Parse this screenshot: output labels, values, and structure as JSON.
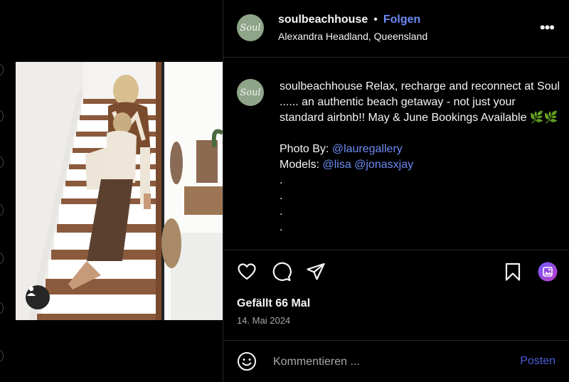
{
  "post": {
    "username": "soulbeachhouse",
    "separator": "•",
    "follow_label": "Folgen",
    "location": "Alexandra Headland, Queensland",
    "more_label": "•••",
    "avatar_text": "Soul",
    "caption": {
      "username": "soulbeachhouse",
      "text_line": " Relax, recharge and reconnect at Soul ...... an authentic beach getaway - not just your standard airbnb!! May & June Bookings Available 🌿🌿",
      "photo_label": "Photo By: ",
      "photo_link": "@lauregallery",
      "models_label": "Models: ",
      "models_link_1": "@lisa",
      "models_link_2": "@jonasxjay",
      "dots": [
        ".",
        ".",
        ".",
        "."
      ]
    },
    "likes": "Gefällt 66 Mal",
    "date": "14. Mai 2024",
    "comment_placeholder": "Kommentieren ...",
    "post_button": "Posten"
  },
  "icons": {
    "like": "heart-icon",
    "comment": "comment-bubble-icon",
    "share": "paper-plane-icon",
    "save": "bookmark-icon",
    "media": "image-icon",
    "emoji": "smiley-icon",
    "tagged": "user-icon"
  },
  "colors": {
    "background": "#000000",
    "link": "#6d8cf5",
    "post_button": "#4a5ed8",
    "avatar_bg": "#8fa589",
    "media_icon_gradient": [
      "#6f5cff",
      "#c13cc7"
    ]
  }
}
